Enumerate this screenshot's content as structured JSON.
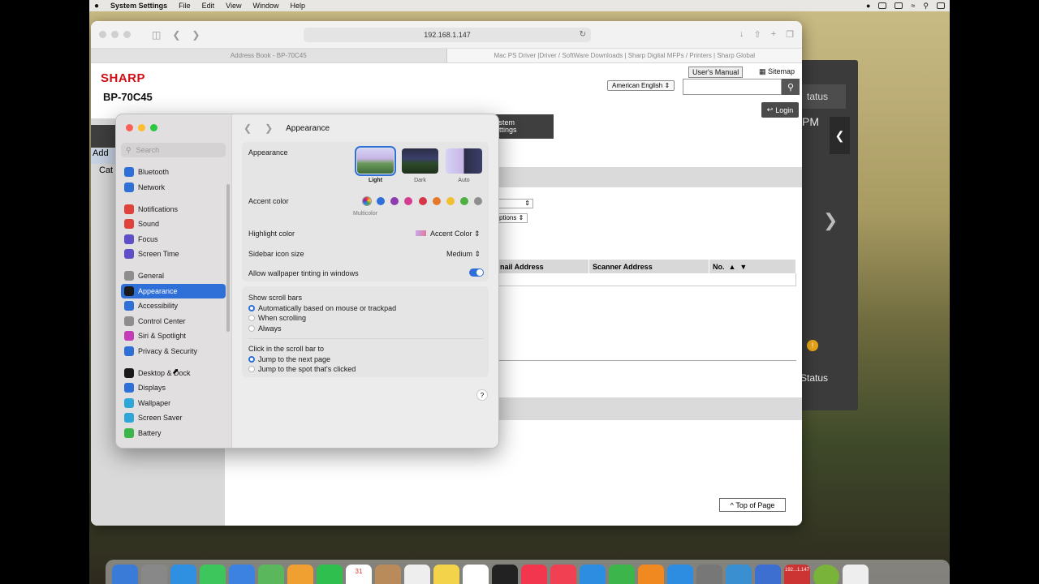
{
  "menubar": {
    "app": "System Settings",
    "items": [
      "File",
      "Edit",
      "View",
      "Window",
      "Help"
    ]
  },
  "browser": {
    "url": "192.168.1.147",
    "tabs": [
      {
        "label": "Address Book - BP-70C45"
      },
      {
        "label": "Mac PS Driver |Driver / SoftWare Downloads | Sharp Digital MFPs / Printers | Sharp Global"
      }
    ]
  },
  "sharp": {
    "logo": "SHARP",
    "model": "BP-70C45",
    "manual": "User's Manual",
    "sitemap": "Sitemap",
    "language": "American English",
    "login": "Login",
    "nav_item1": "Add",
    "nav_item2": "Cat",
    "tab_system_line1": "ystem",
    "tab_system_line2": "ettings",
    "select1_suffix": "",
    "select2_text": "ptions",
    "table_cols": [
      "nail Address",
      "Scanner Address",
      "No."
    ],
    "top_of_page": "Top of Page"
  },
  "dark_panel": {
    "status_top": "tatus",
    "pm": "PM",
    "status_bottom": "Status",
    "warn": "!"
  },
  "settings": {
    "search_placeholder": "Search",
    "title": "Appearance",
    "sidebar": [
      {
        "label": "Bluetooth",
        "icon": "bluetooth-icon",
        "color": "#2e6fd8",
        "group": 0
      },
      {
        "label": "Network",
        "icon": "globe-icon",
        "color": "#2e6fd8",
        "group": 0
      },
      {
        "label": "Notifications",
        "icon": "bell-icon",
        "color": "#e0413a",
        "group": 1
      },
      {
        "label": "Sound",
        "icon": "speaker-icon",
        "color": "#e0413a",
        "group": 1
      },
      {
        "label": "Focus",
        "icon": "moon-icon",
        "color": "#5e4fc9",
        "group": 1
      },
      {
        "label": "Screen Time",
        "icon": "hourglass-icon",
        "color": "#5e4fc9",
        "group": 1
      },
      {
        "label": "General",
        "icon": "gear-icon",
        "color": "#8e8e8e",
        "group": 2
      },
      {
        "label": "Appearance",
        "icon": "appearance-icon",
        "color": "#1a1a1a",
        "group": 2,
        "selected": true
      },
      {
        "label": "Accessibility",
        "icon": "accessibility-icon",
        "color": "#2e6fd8",
        "group": 2
      },
      {
        "label": "Control Center",
        "icon": "toggles-icon",
        "color": "#8e8e8e",
        "group": 2
      },
      {
        "label": "Siri & Spotlight",
        "icon": "siri-icon",
        "color": "#c33db8",
        "group": 2
      },
      {
        "label": "Privacy & Security",
        "icon": "hand-icon",
        "color": "#2e6fd8",
        "group": 2
      },
      {
        "label": "Desktop & Dock",
        "icon": "dock-icon",
        "color": "#1a1a1a",
        "group": 3
      },
      {
        "label": "Displays",
        "icon": "sun-icon",
        "color": "#2e6fd8",
        "group": 3
      },
      {
        "label": "Wallpaper",
        "icon": "wallpaper-icon",
        "color": "#2ea7d8",
        "group": 3
      },
      {
        "label": "Screen Saver",
        "icon": "screensaver-icon",
        "color": "#2ea7d8",
        "group": 3
      },
      {
        "label": "Battery",
        "icon": "battery-icon",
        "color": "#3cb54a",
        "group": 3
      }
    ],
    "appearance_label": "Appearance",
    "modes": [
      "Light",
      "Dark",
      "Auto"
    ],
    "accent_label": "Accent color",
    "accent_colors": [
      "#2e6fd8",
      "#8d3bb0",
      "#d43d8f",
      "#d6364a",
      "#e5782b",
      "#f0c02d",
      "#4eb043",
      "#8e8e8e"
    ],
    "multicolor_label": "Multicolor",
    "highlight_label": "Highlight color",
    "highlight_value": "Accent Color",
    "sidebar_icon_label": "Sidebar icon size",
    "sidebar_icon_value": "Medium",
    "tinting_label": "Allow wallpaper tinting in windows",
    "tinting_on": true,
    "scroll_bars_label": "Show scroll bars",
    "scroll_options": [
      "Automatically based on mouse or trackpad",
      "When scrolling",
      "Always"
    ],
    "click_label": "Click in the scroll bar to",
    "click_options": [
      "Jump to the next page",
      "Jump to the spot that's clicked"
    ],
    "help": "?"
  },
  "dock": {
    "calendar_day": "31",
    "badge": "192...1.147"
  }
}
